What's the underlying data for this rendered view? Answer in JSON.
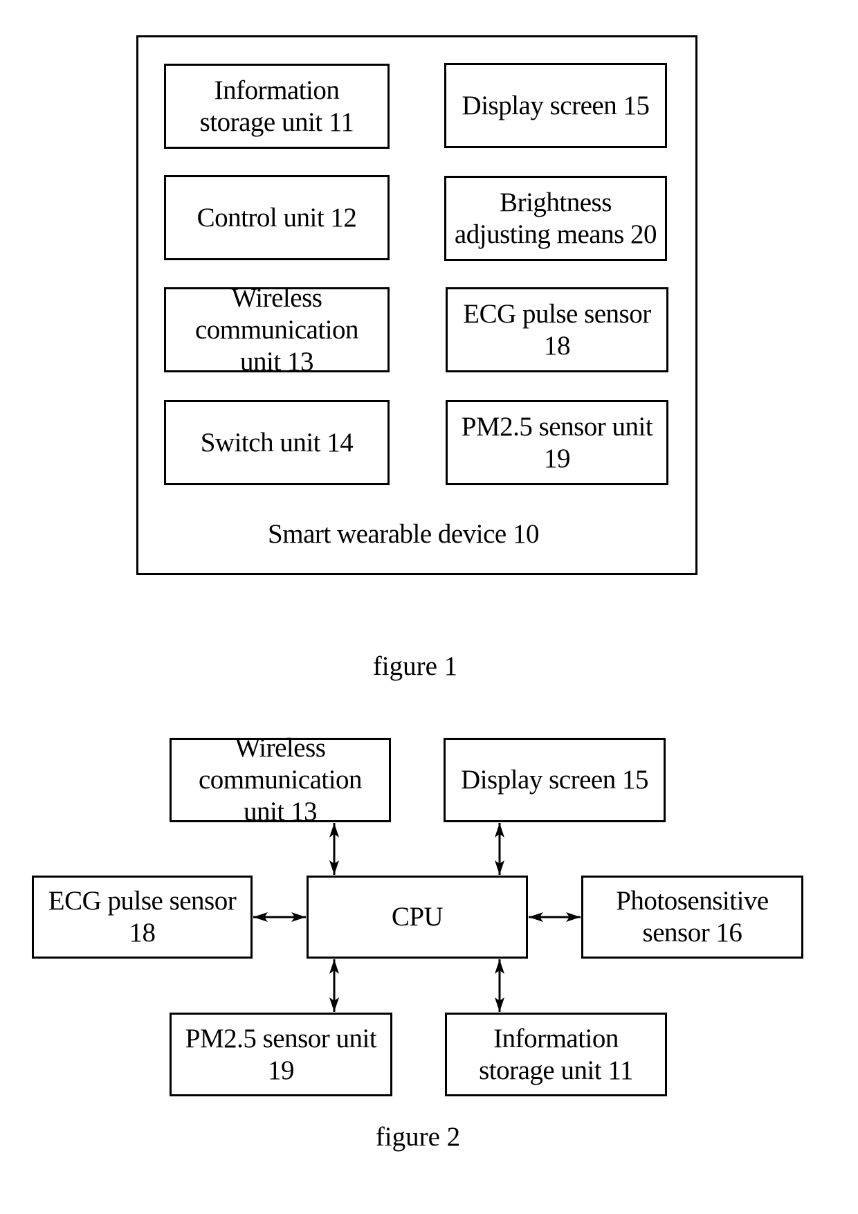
{
  "figure1": {
    "container_label": "Smart wearable device 10",
    "caption": "figure 1",
    "left_column": [
      {
        "id": "information-storage-unit-11",
        "label": "Information\nstorage unit 11"
      },
      {
        "id": "control-unit-12",
        "label": "Control unit 12"
      },
      {
        "id": "wireless-communication-unit-13",
        "label": "Wireless\ncommunication\nunit 13"
      },
      {
        "id": "switch-unit-14",
        "label": "Switch unit 14"
      }
    ],
    "right_column": [
      {
        "id": "display-screen-15",
        "label": "Display screen 15"
      },
      {
        "id": "brightness-adjusting-means-20",
        "label": "Brightness\nadjusting means 20"
      },
      {
        "id": "ecg-pulse-sensor-18",
        "label": "ECG pulse sensor\n18"
      },
      {
        "id": "pm25-sensor-unit-19",
        "label": "PM2.5 sensor unit\n19"
      }
    ]
  },
  "figure2": {
    "caption": "figure 2",
    "center": {
      "id": "cpu",
      "label": "CPU"
    },
    "nodes": {
      "top_left": {
        "id": "wireless-communication-unit-13",
        "label": "Wireless\ncommunication\nunit 13"
      },
      "top_right": {
        "id": "display-screen-15",
        "label": "Display screen 15"
      },
      "left": {
        "id": "ecg-pulse-sensor-18",
        "label": "ECG pulse sensor\n18"
      },
      "right": {
        "id": "photosensitive-sensor-16",
        "label": "Photosensitive\nsensor 16"
      },
      "bottom_left": {
        "id": "pm25-sensor-unit-19",
        "label": "PM2.5 sensor unit\n19"
      },
      "bottom_right": {
        "id": "information-storage-unit-11",
        "label": "Information\nstorage unit 11"
      }
    },
    "connections": [
      {
        "from": "cpu",
        "to": "wireless-communication-unit-13",
        "direction": "bidirectional"
      },
      {
        "from": "cpu",
        "to": "display-screen-15",
        "direction": "bidirectional"
      },
      {
        "from": "cpu",
        "to": "ecg-pulse-sensor-18",
        "direction": "bidirectional"
      },
      {
        "from": "cpu",
        "to": "photosensitive-sensor-16",
        "direction": "bidirectional"
      },
      {
        "from": "cpu",
        "to": "pm25-sensor-unit-19",
        "direction": "bidirectional"
      },
      {
        "from": "cpu",
        "to": "information-storage-unit-11",
        "direction": "bidirectional"
      }
    ]
  }
}
